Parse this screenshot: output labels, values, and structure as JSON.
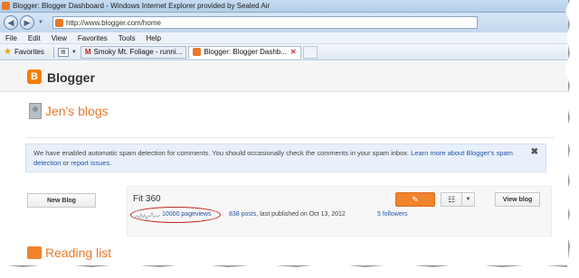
{
  "window": {
    "title": "Blogger: Blogger Dashboard - Windows Internet Explorer provided by Sealed Air"
  },
  "address_bar": {
    "url": "http://www.blogger.com/home"
  },
  "menu": {
    "items": [
      "File",
      "Edit",
      "View",
      "Favorites",
      "Tools",
      "Help"
    ]
  },
  "favorites_bar": {
    "favorites_label": "Favorites",
    "tabs": [
      {
        "label": "Smoky Mt. Foliage - runni...",
        "icon": "gmail-icon",
        "active": false
      },
      {
        "label": "Blogger: Blogger Dashb...",
        "icon": "blogger-icon",
        "active": true
      }
    ]
  },
  "blogger": {
    "brand": "Blogger",
    "page_title": "Jen's blogs",
    "notice": {
      "text_before": "We have enabled automatic spam detection for comments. You should occasionally check the comments in your spam inbox. ",
      "link_learn_more": "Learn more about Blogger's spam detection",
      "text_or": " or ",
      "link_report": "report issues",
      "text_end": "."
    },
    "new_blog_label": "New Blog",
    "blog": {
      "name": "Fit 360",
      "pageviews": "10000 pageviews",
      "posts_link": "838 posts",
      "published_text": ", last published on Oct 13, 2012",
      "followers": "5 followers",
      "view_blog_label": "View blog"
    },
    "reading_list_title": "Reading list"
  },
  "colors": {
    "accent": "#e8792b",
    "link": "#2255aa",
    "highlight_oval": "#c0241d"
  }
}
